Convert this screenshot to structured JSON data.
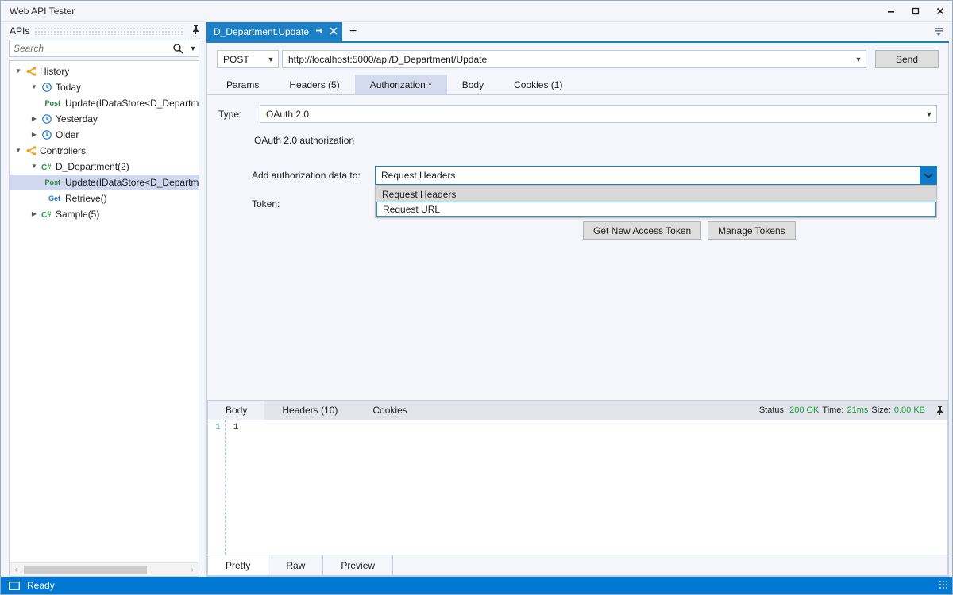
{
  "window": {
    "title": "Web API Tester",
    "minimize_label": "Minimize",
    "maximize_label": "Maximize",
    "close_label": "Close"
  },
  "sidebar": {
    "header": "APIs",
    "pin_icon": "pin-icon",
    "search": {
      "placeholder": "Search",
      "value": "",
      "icon": "search-icon",
      "dropdown_icon": "chevron-down-icon"
    },
    "tree": [
      {
        "label": "History",
        "indent": 0,
        "twisty": "expanded",
        "icon": "branch-icon",
        "verb": ""
      },
      {
        "label": "Today",
        "indent": 1,
        "twisty": "expanded",
        "icon": "clock-icon",
        "verb": ""
      },
      {
        "label": "Update(IDataStore<D_Departme",
        "indent": 2,
        "twisty": "none",
        "icon": "",
        "verb": "Post"
      },
      {
        "label": "Yesterday",
        "indent": 1,
        "twisty": "collapsed",
        "icon": "clock-icon",
        "verb": ""
      },
      {
        "label": "Older",
        "indent": 1,
        "twisty": "collapsed",
        "icon": "clock-icon",
        "verb": ""
      },
      {
        "label": "Controllers",
        "indent": 0,
        "twisty": "expanded",
        "icon": "branch-icon",
        "verb": ""
      },
      {
        "label": "D_Department(2)",
        "indent": 1,
        "twisty": "expanded",
        "icon": "csharp-icon",
        "verb": ""
      },
      {
        "label": "Update(IDataStore<D_Departme",
        "indent": 2,
        "twisty": "none",
        "icon": "",
        "verb": "Post",
        "selected": true
      },
      {
        "label": "Retrieve()",
        "indent": 2,
        "twisty": "none",
        "icon": "",
        "verb": "Get"
      },
      {
        "label": "Sample(5)",
        "indent": 1,
        "twisty": "collapsed",
        "icon": "csharp-icon",
        "verb": ""
      }
    ],
    "scroll_left_icon": "chevron-left-icon",
    "scroll_right_icon": "chevron-right-icon"
  },
  "tabstrip": {
    "tabs": [
      {
        "title": "D_Department.Update",
        "pin_icon": "pin-icon",
        "close_icon": "close-icon",
        "active": true
      }
    ],
    "new_tab_label": "+",
    "menu_icon": "tab-list-icon"
  },
  "request": {
    "method": "POST",
    "method_caret_icon": "chevron-down-icon",
    "url": "http://localhost:5000/api/D_Department/Update",
    "url_caret_icon": "chevron-down-icon",
    "send_label": "Send",
    "tabs": [
      {
        "label": "Params",
        "active": false
      },
      {
        "label": "Headers (5)",
        "active": false
      },
      {
        "label": "Authorization *",
        "active": true
      },
      {
        "label": "Body",
        "active": false
      },
      {
        "label": "Cookies (1)",
        "active": false
      }
    ]
  },
  "authorization": {
    "type_label": "Type:",
    "type_value": "OAuth 2.0",
    "type_caret_icon": "chevron-down-icon",
    "description": "OAuth 2.0 authorization",
    "add_to_label": "Add authorization data to:",
    "add_to_value": "Request Headers",
    "add_to_caret_icon": "chevron-down-icon",
    "dropdown_open": true,
    "dropdown_options": [
      {
        "label": "Request Headers",
        "highlighted": true,
        "current": false
      },
      {
        "label": "Request URL",
        "highlighted": false,
        "current": true
      }
    ],
    "token_label": "Token:",
    "token_value": "",
    "get_token_label": "Get New Access Token",
    "manage_tokens_label": "Manage Tokens"
  },
  "response": {
    "tabs": [
      {
        "label": "Body",
        "active": true
      },
      {
        "label": "Headers (10)",
        "active": false
      },
      {
        "label": "Cookies",
        "active": false
      }
    ],
    "status_key": "Status:",
    "status_value": "200 OK",
    "time_key": "Time:",
    "time_value": "21ms",
    "size_key": "Size:",
    "size_value": "0.00 KB",
    "pin_icon": "pin-icon",
    "line_number": "1",
    "body_text": "1",
    "footer_tabs": [
      {
        "label": "Pretty",
        "active": true
      },
      {
        "label": "Raw",
        "active": false
      },
      {
        "label": "Preview",
        "active": false
      }
    ]
  },
  "statusbar": {
    "icon": "window-icon",
    "text": "Ready"
  },
  "colors": {
    "accent": "#0078d4",
    "tab_active": "#1d7fc4",
    "status_ok": "#1a9a3a",
    "verb_post": "#1e7f37",
    "verb_get": "#1f77c8",
    "tree_selection": "#cfd8ef"
  }
}
